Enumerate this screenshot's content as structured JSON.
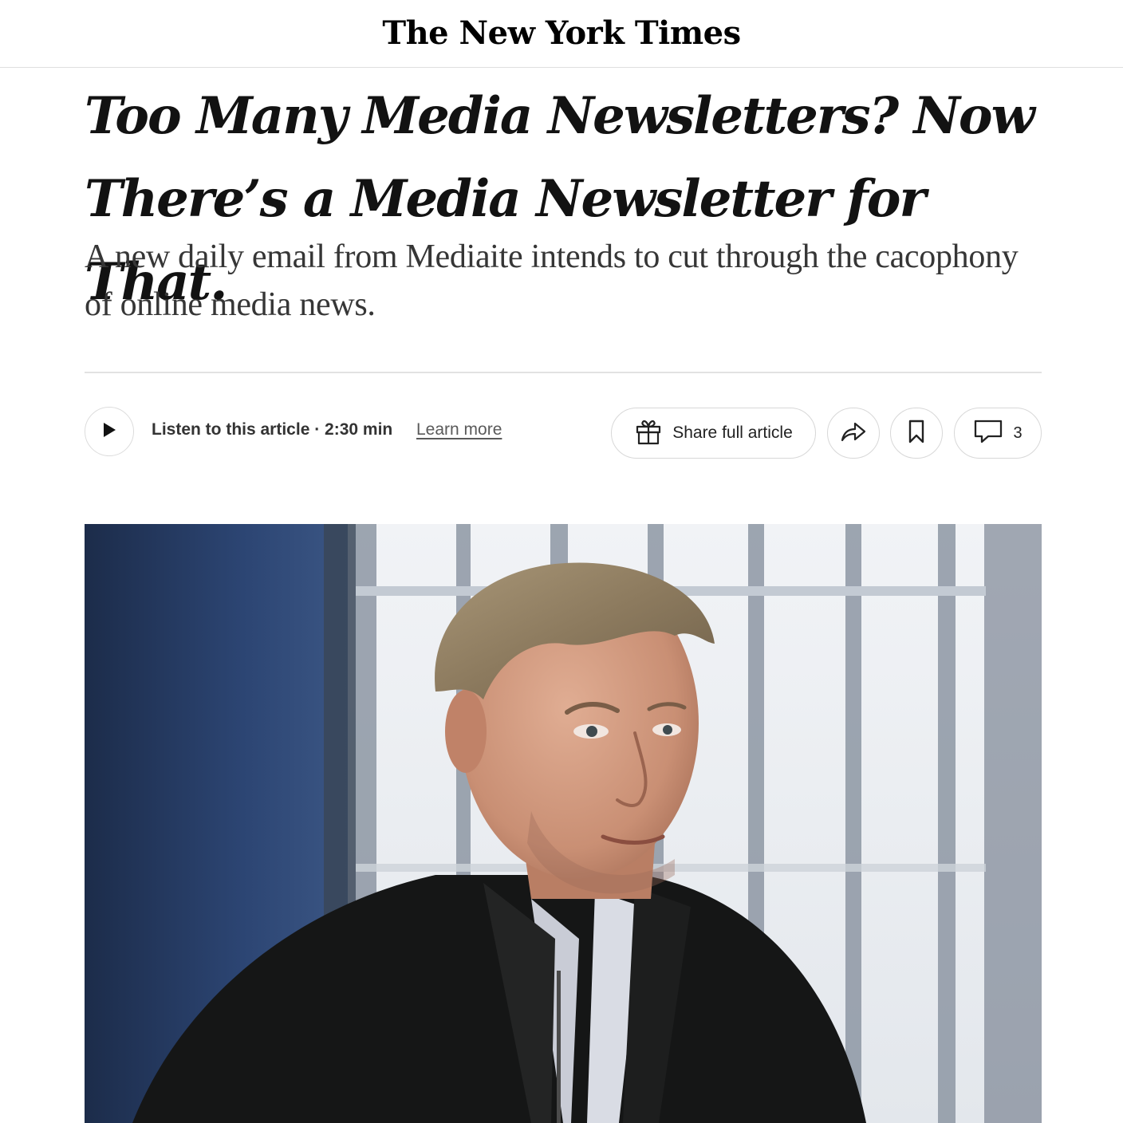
{
  "masthead": {
    "logo_text": "The New York Times"
  },
  "article": {
    "headline": "Too Many Media Newsletters? Now There’s a Media Newsletter for That.",
    "summary": "A new daily email from Mediaite intends to cut through the cacophony of online media news."
  },
  "toolbar": {
    "play_icon": "play-icon",
    "listen_label": "Listen to this article · 2:30 min",
    "learn_more_label": "Learn more",
    "share_full_label": "Share full article",
    "share_full_icon": "gift-icon",
    "share_icon": "share-arrow-icon",
    "save_icon": "bookmark-icon",
    "comments_icon": "comment-icon",
    "comments_count": "3"
  },
  "colors": {
    "text": "#121212",
    "summary_text": "#363636",
    "rule": "#e2e2e2",
    "pill_border": "#d8d8d8"
  }
}
